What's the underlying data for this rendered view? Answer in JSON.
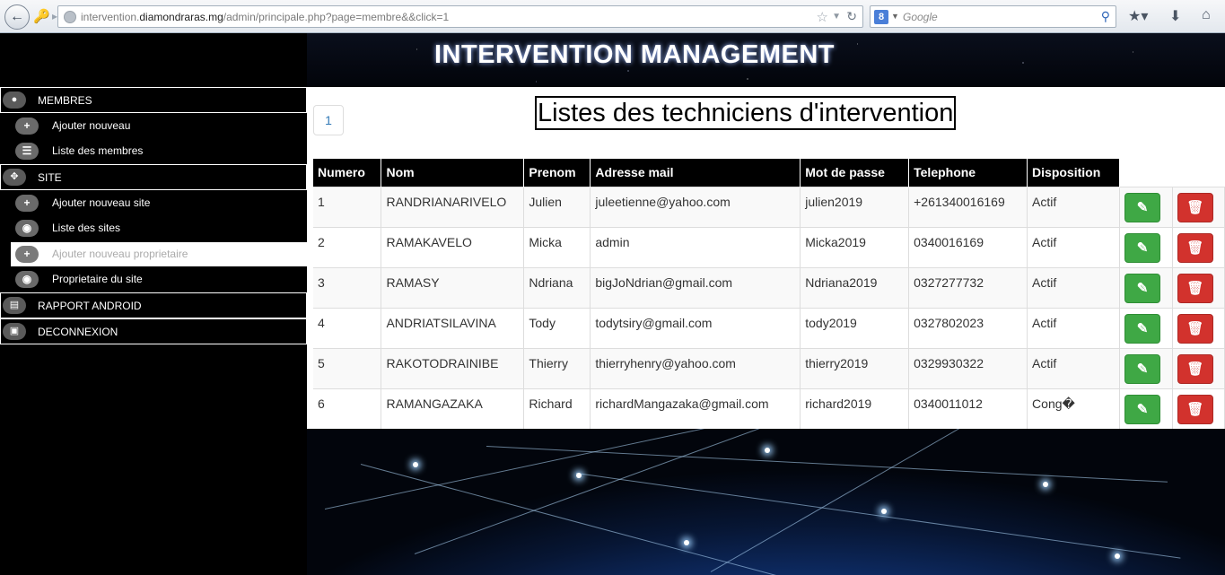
{
  "browser": {
    "url_prefix": "intervention.",
    "url_domain": "diamondraras.mg",
    "url_path": "/admin/principale.php?page=membre&&click=1",
    "search_placeholder": "Google"
  },
  "site_title": "INTERVENTION MANAGEMENT",
  "sidebar": {
    "sections": [
      {
        "label": "MEMBRES",
        "icon": "user-icon"
      },
      {
        "label": "SITE",
        "icon": "crosshair-icon"
      },
      {
        "label": "RAPPORT ANDROID",
        "icon": "clipboard-icon"
      },
      {
        "label": "DECONNEXION",
        "icon": "lock-icon"
      }
    ],
    "items": [
      {
        "label": "Ajouter nouveau",
        "icon": "plus-icon"
      },
      {
        "label": "Liste des membres",
        "icon": "list-icon"
      },
      {
        "label": "Ajouter nouveau site",
        "icon": "plus-icon"
      },
      {
        "label": "Liste des sites",
        "icon": "globe-icon"
      },
      {
        "label": "Ajouter nouveau proprietaire",
        "icon": "plus-icon",
        "active": true
      },
      {
        "label": "Proprietaire du site",
        "icon": "globe-icon"
      }
    ]
  },
  "main": {
    "pager_current": "1",
    "list_title": "Listes des techniciens d'intervention",
    "columns": [
      "Numero",
      "Nom",
      "Prenom",
      "Adresse mail",
      "Mot de passe",
      "Telephone",
      "Disposition"
    ],
    "rows": [
      [
        "1",
        "RANDRIANARIVELO",
        "Julien",
        "juleetienne@yahoo.com",
        "julien2019",
        "+261340016169",
        "Actif"
      ],
      [
        "2",
        "RAMAKAVELO",
        "Micka",
        "admin",
        "Micka2019",
        "0340016169",
        "Actif"
      ],
      [
        "3",
        "RAMASY",
        "Ndriana",
        "bigJoNdrian@gmail.com",
        "Ndriana2019",
        "0327277732",
        "Actif"
      ],
      [
        "4",
        "ANDRIATSILAVINA",
        "Tody",
        "todytsiry@gmail.com",
        "tody2019",
        "0327802023",
        "Actif"
      ],
      [
        "5",
        "RAKOTODRAINIBE",
        "Thierry",
        "thierryhenry@yahoo.com",
        "thierry2019",
        "0329930322",
        "Actif"
      ],
      [
        "6",
        "RAMANGAZAKA",
        "Richard",
        "richardMangazaka@gmail.com",
        "richard2019",
        "0340011012",
        "Cong�"
      ]
    ]
  },
  "colors": {
    "edit_button": "#3fa845",
    "delete_button": "#d2322d",
    "header_bg": "#000000"
  }
}
